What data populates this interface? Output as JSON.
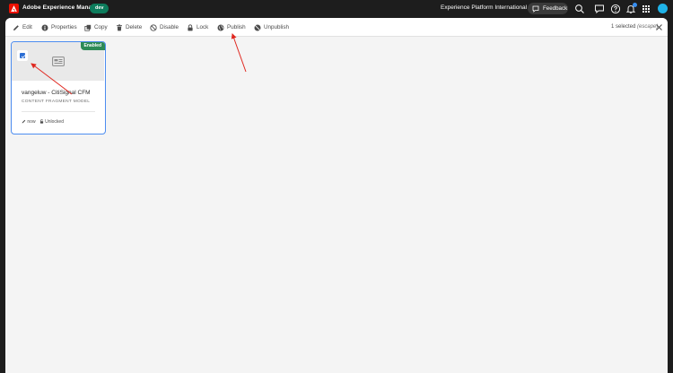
{
  "shell": {
    "app_title": "Adobe Experience Manager",
    "env_badge": "dev",
    "org_name": "Experience Platform International",
    "feedback_label": "Feedback",
    "icons": [
      "search-icon",
      "chat-icon",
      "help-icon",
      "bell-icon",
      "apps-grid-icon",
      "avatar"
    ]
  },
  "action_bar": {
    "edit": "Edit",
    "properties": "Properties",
    "copy": "Copy",
    "delete": "Delete",
    "disable": "Disable",
    "lock": "Lock",
    "publish": "Publish",
    "unpublish": "Unpublish",
    "selected_count": "1 selected",
    "escape_hint": "(escape)"
  },
  "card": {
    "status": "Enabled",
    "title": "vangeluw - CitiSignal CFM",
    "type": "CONTENT FRAGMENT MODEL",
    "modified": "now",
    "lock_state": "Unlocked",
    "checked": true
  },
  "colors": {
    "shell_bg": "#1d1d1d",
    "adobe_red": "#eb1000",
    "env_badge": "#0d7c5c",
    "status_enabled": "#2d8a56",
    "selection_blue": "#4d8df0",
    "annotation_red": "#e0271f"
  }
}
